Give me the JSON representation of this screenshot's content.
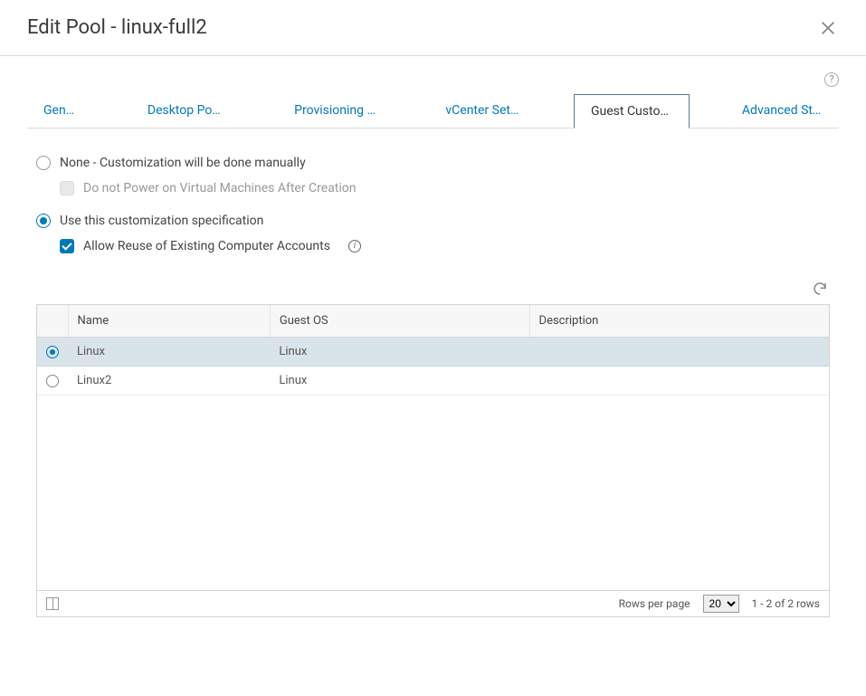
{
  "header": {
    "title": "Edit Pool - linux-full2"
  },
  "tabs": {
    "items": [
      {
        "label": "General"
      },
      {
        "label": "Desktop Pool S..."
      },
      {
        "label": "Provisioning Set..."
      },
      {
        "label": "vCenter Settings"
      },
      {
        "label": "Guest Customiz..."
      },
      {
        "label": "Advanced Stora..."
      }
    ],
    "activeIndex": 4
  },
  "options": {
    "none": {
      "label": "None - Customization will be done manually",
      "sub": "Do not Power on Virtual Machines After Creation"
    },
    "usespec": {
      "label": "Use this customization specification",
      "sub": "Allow Reuse of Existing Computer Accounts"
    }
  },
  "table": {
    "columns": {
      "name": "Name",
      "guestos": "Guest OS",
      "description": "Description"
    },
    "rows": [
      {
        "name": "Linux",
        "guestos": "Linux",
        "description": ""
      },
      {
        "name": "Linux2",
        "guestos": "Linux",
        "description": ""
      }
    ],
    "footer": {
      "rowsPerPageLabel": "Rows per page",
      "rowsPerPageValue": "20",
      "rangeText": "1 - 2 of 2 rows"
    }
  }
}
